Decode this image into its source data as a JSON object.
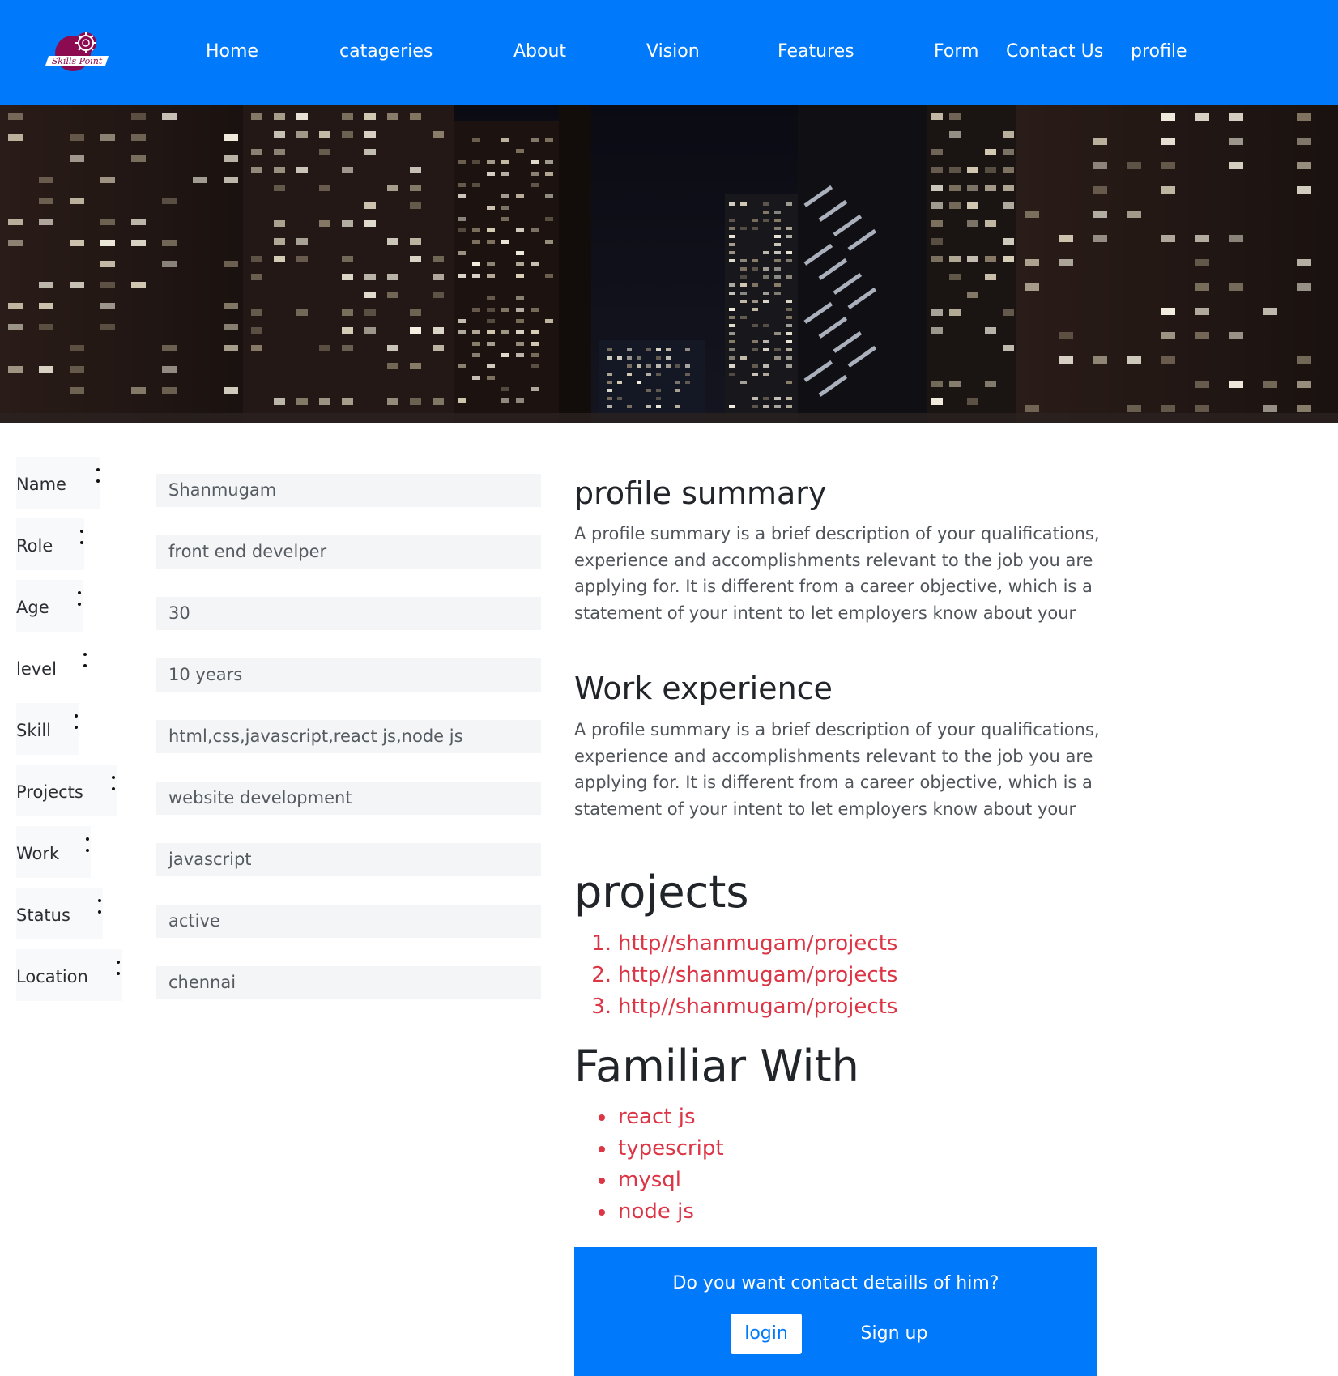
{
  "brand": {
    "logo_text": "Skills Point",
    "logo_color": "#8b0a50",
    "nav_color": "#0079fb"
  },
  "nav": {
    "home": "Home",
    "categories": "catageries",
    "about": "About",
    "vision": "Vision",
    "features": "Features",
    "form": "Form",
    "contact": "Contact Us",
    "profile": "profile"
  },
  "hero": {
    "image": "night city skyline with lit office towers"
  },
  "profile_form": [
    {
      "label": "Name",
      "value": "Shanmugam"
    },
    {
      "label": "Role",
      "value": "front end develper"
    },
    {
      "label": "Age",
      "value": "30"
    },
    {
      "label": "level",
      "value": "10 years"
    },
    {
      "label": "Skill",
      "value": "html,css,javascript,react js,node js"
    },
    {
      "label": "Projects",
      "value": "website development"
    },
    {
      "label": "Work",
      "value": "javascript"
    },
    {
      "label": "Status",
      "value": "active"
    },
    {
      "label": "Location",
      "value": "chennai"
    }
  ],
  "summary": {
    "heading": "profile summary",
    "text": "A profile summary is a brief description of your qualifications, experience and accomplishments relevant to the job you are applying for. It is different from a career objective, which is a statement of your intent to let employers know about your"
  },
  "work": {
    "heading": "Work experience",
    "text": "A profile summary is a brief description of your qualifications, experience and accomplishments relevant to the job you are applying for. It is different from a career objective, which is a statement of your intent to let employers know about your"
  },
  "projects": {
    "heading": "projects",
    "items": [
      {
        "num": "1.",
        "link": "http//shanmugam/projects"
      },
      {
        "num": "2.",
        "link": "http//shanmugam/projects"
      },
      {
        "num": "3.",
        "link": "http//shanmugam/projects"
      }
    ]
  },
  "familiar": {
    "heading": "Familiar With",
    "items": [
      "react js",
      "typescript",
      "mysql",
      "node js"
    ]
  },
  "contact": {
    "question": "Do you want contact detaills of him?",
    "login": "login",
    "signup": "Sign up"
  },
  "colors": {
    "accent": "#0079fb",
    "link": "#dc3545"
  }
}
